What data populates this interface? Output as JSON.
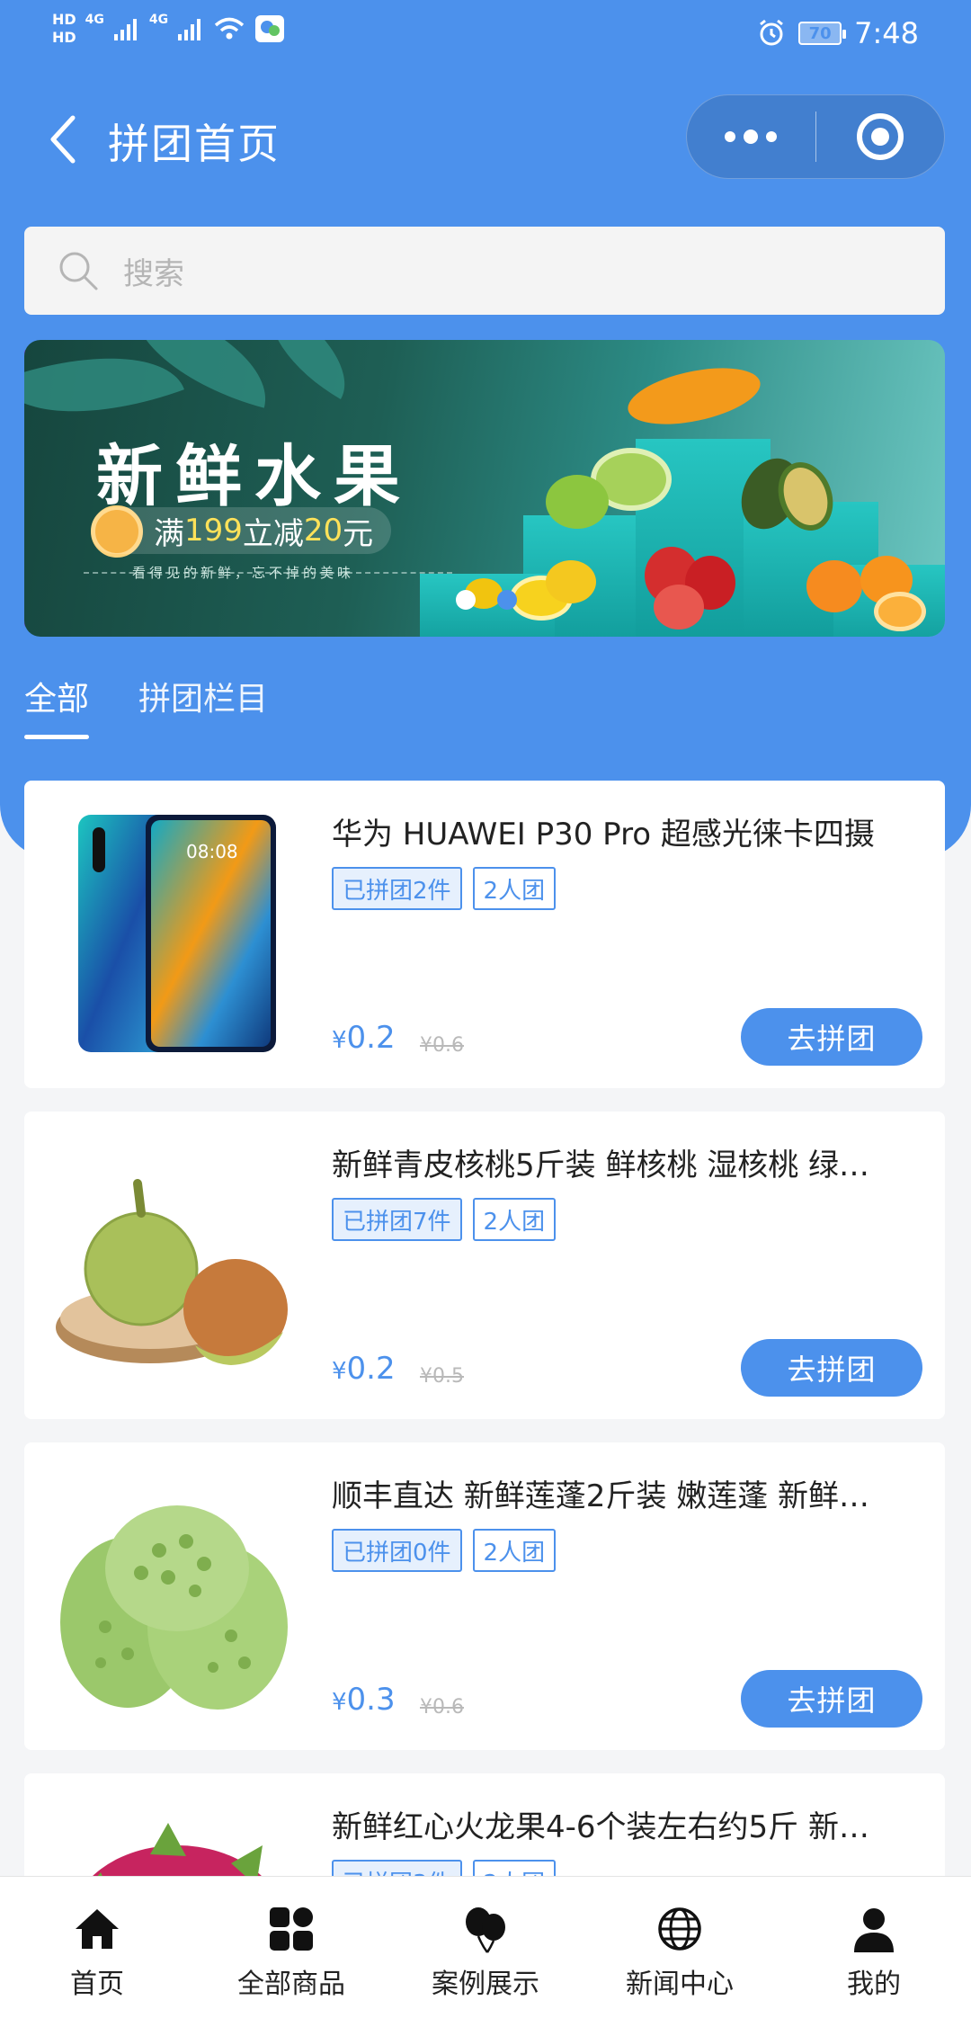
{
  "status_bar": {
    "hd1": "HD",
    "hd2": "HD",
    "net1": "4G",
    "net2": "4G",
    "battery": "70",
    "time": "7:48"
  },
  "nav": {
    "title": "拼团首页"
  },
  "search": {
    "placeholder": "搜索"
  },
  "banner": {
    "title": "新鲜水果",
    "promo_prefix": "满",
    "promo_amount": "199",
    "promo_mid": "立减",
    "promo_discount": "20",
    "promo_suffix": "元",
    "subtitle": "看得见的新鲜，忘不掉的美味",
    "page_count": 2,
    "active_page": 2
  },
  "tabs": [
    {
      "label": "全部",
      "active": true
    },
    {
      "label": "拼团栏目",
      "active": false
    }
  ],
  "products": [
    {
      "title": "华为 HUAWEI P30 Pro 超感光徕卡四摄",
      "joined": "已拼团2件",
      "group": "2人团",
      "price": "0.2",
      "original": "¥0.6",
      "button": "去拼团"
    },
    {
      "title": "新鲜青皮核桃5斤装 鲜核桃 湿核桃 绿…",
      "joined": "已拼团7件",
      "group": "2人团",
      "price": "0.2",
      "original": "¥0.5",
      "button": "去拼团"
    },
    {
      "title": "顺丰直达 新鲜莲蓬2斤装 嫩莲蓬 新鲜…",
      "joined": "已拼团0件",
      "group": "2人团",
      "price": "0.3",
      "original": "¥0.6",
      "button": "去拼团"
    },
    {
      "title": "新鲜红心火龙果4-6个装左右约5斤 新…",
      "joined": "已拼团3件",
      "group": "2人团",
      "price": "",
      "original": "",
      "button": "去拼团"
    }
  ],
  "currency": "¥",
  "tabbar": [
    {
      "label": "首页",
      "icon": "home-icon"
    },
    {
      "label": "全部商品",
      "icon": "grid-icon"
    },
    {
      "label": "案例展示",
      "icon": "balloons-icon"
    },
    {
      "label": "新闻中心",
      "icon": "globe-icon"
    },
    {
      "label": "我的",
      "icon": "user-icon"
    }
  ],
  "colors": {
    "primary": "#4c91ec",
    "background": "#f4f5f7"
  }
}
